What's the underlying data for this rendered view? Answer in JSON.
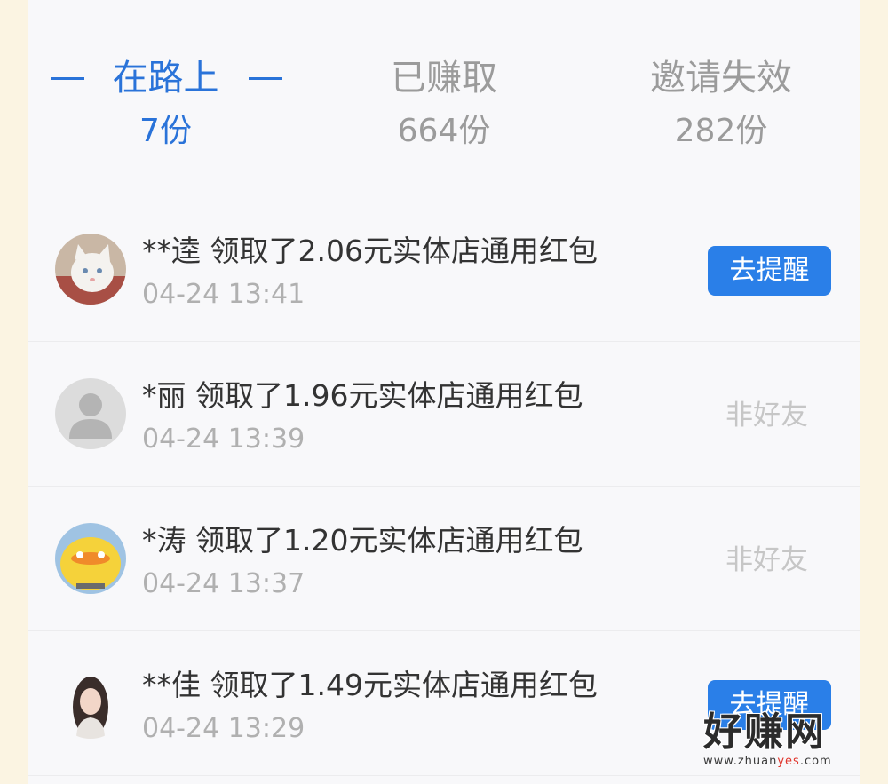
{
  "tabs": [
    {
      "label": "在路上",
      "count": "7份",
      "active": true
    },
    {
      "label": "已赚取",
      "count": "664份",
      "active": false
    },
    {
      "label": "邀请失效",
      "count": "282份",
      "active": false
    }
  ],
  "records": [
    {
      "title": "**逵 领取了2.06元实体店通用红包",
      "time": "04-24 13:41",
      "action": "去提醒",
      "avatar": "white-cat-avatar"
    },
    {
      "title": "*丽 领取了1.96元实体店通用红包",
      "time": "04-24 13:39",
      "status": "非好友",
      "avatar": "default-person-avatar"
    },
    {
      "title": "*涛 领取了1.20元实体店通用红包",
      "time": "04-24 13:37",
      "status": "非好友",
      "avatar": "cartoon-duck-avatar"
    },
    {
      "title": "**佳 领取了1.49元实体店通用红包",
      "time": "04-24 13:29",
      "action": "去提醒",
      "avatar": "girl-photo-avatar"
    }
  ],
  "watermark": {
    "main": "好赚网",
    "sub_a": "www.zhuan",
    "sub_b": "yes",
    "sub_c": ".com"
  },
  "colors": {
    "accent": "#2a73d9",
    "button": "#2a7fe8",
    "background": "#fbf4e2"
  }
}
